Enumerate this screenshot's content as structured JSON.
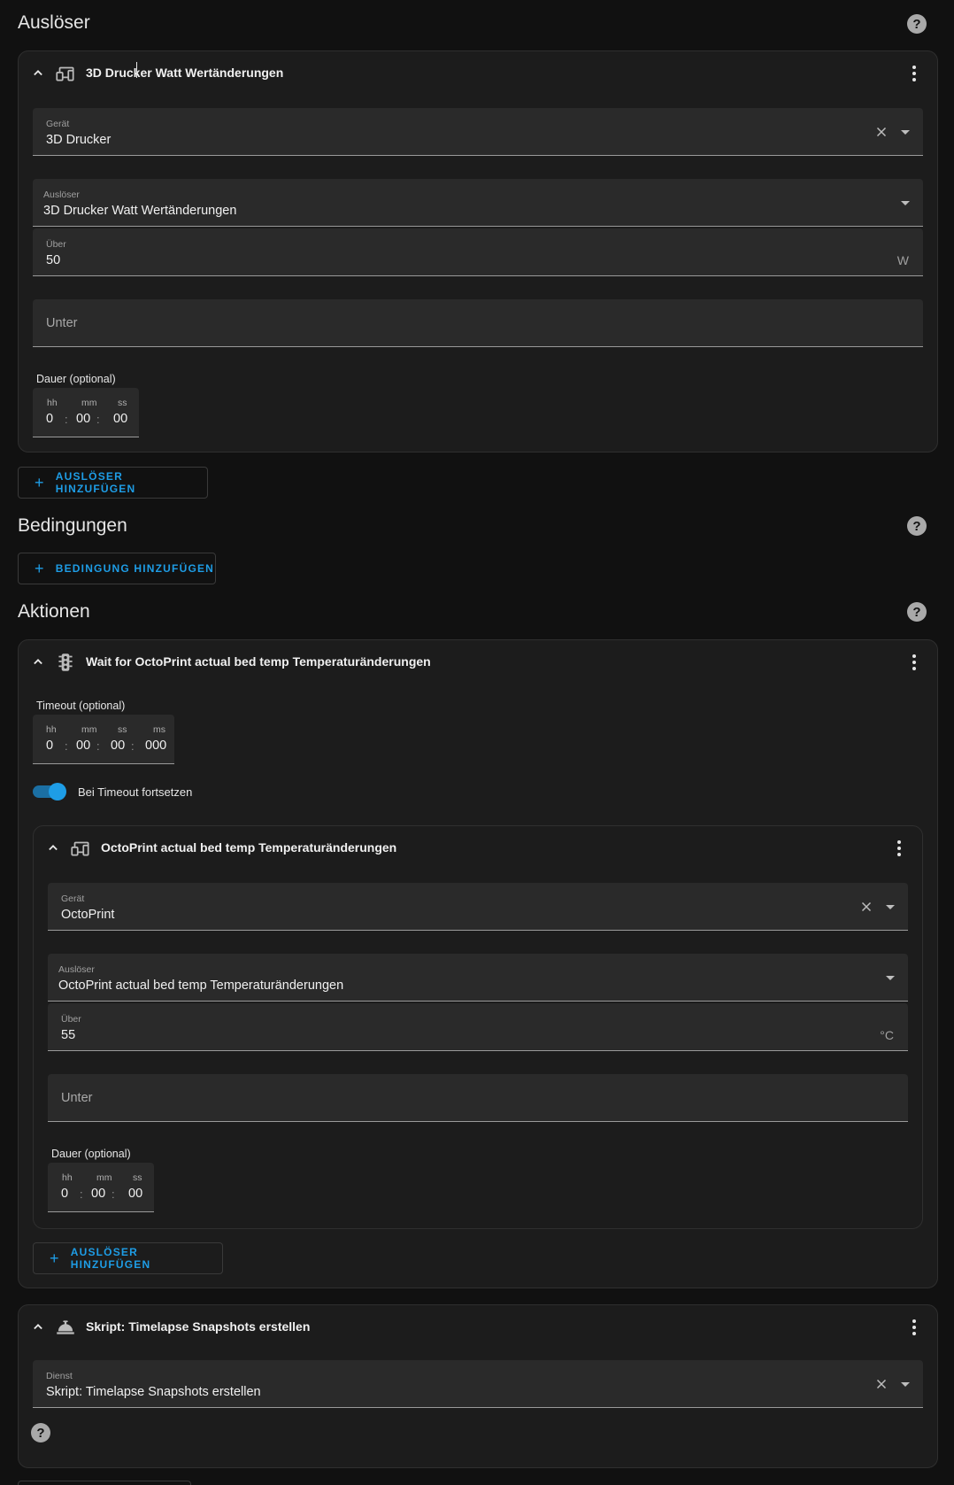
{
  "triggers": {
    "title": "Auslöser",
    "card": {
      "title": "3D Drucker Watt Wertänderungen",
      "device_label": "Gerät",
      "device_value": "3D Drucker",
      "trigger_label": "Auslöser",
      "trigger_value": "3D Drucker Watt Wertänderungen",
      "above_label": "Über",
      "above_value": "50",
      "above_unit": "W",
      "below_placeholder": "Unter",
      "duration_label": "Dauer (optional)",
      "duration": {
        "hh_label": "hh",
        "mm_label": "mm",
        "ss_label": "ss",
        "hh": "0",
        "mm": "00",
        "ss": "00"
      }
    },
    "add_button": "AUSLÖSER HINZUFÜGEN"
  },
  "conditions": {
    "title": "Bedingungen",
    "add_button": "BEDINGUNG HINZUFÜGEN"
  },
  "actions": {
    "title": "Aktionen",
    "wait_card": {
      "title": "Wait for OctoPrint actual bed temp Temperaturänderungen",
      "timeout_label": "Timeout (optional)",
      "timeout": {
        "hh_label": "hh",
        "mm_label": "mm",
        "ss_label": "ss",
        "ms_label": "ms",
        "hh": "0",
        "mm": "00",
        "ss": "00",
        "ms": "000"
      },
      "continue_label": "Bei Timeout fortsetzen",
      "continue_on": true,
      "inner": {
        "title": "OctoPrint actual bed temp Temperaturänderungen",
        "device_label": "Gerät",
        "device_value": "OctoPrint",
        "trigger_label": "Auslöser",
        "trigger_value": "OctoPrint actual bed temp Temperaturänderungen",
        "above_label": "Über",
        "above_value": "55",
        "above_unit": "°C",
        "below_placeholder": "Unter",
        "duration_label": "Dauer (optional)",
        "duration": {
          "hh_label": "hh",
          "mm_label": "mm",
          "ss_label": "ss",
          "hh": "0",
          "mm": "00",
          "ss": "00"
        }
      },
      "add_button": "AUSLÖSER HINZUFÜGEN"
    },
    "script_card": {
      "title": "Skript: Timelapse Snapshots erstellen",
      "service_label": "Dienst",
      "service_value": "Skript: Timelapse Snapshots erstellen"
    }
  },
  "icons": {
    "help": "help-circle-icon",
    "collapse": "chevron-up-icon",
    "device": "devices-icon",
    "wait": "traffic-light-icon",
    "script": "room-service-icon",
    "menu": "dots-vertical-icon",
    "clear": "close-icon",
    "dropdown": "menu-down-icon"
  },
  "colors": {
    "background": "#111111",
    "card": "#1c1c1c",
    "field": "#2a2a2a",
    "accent": "#1e9de6"
  }
}
